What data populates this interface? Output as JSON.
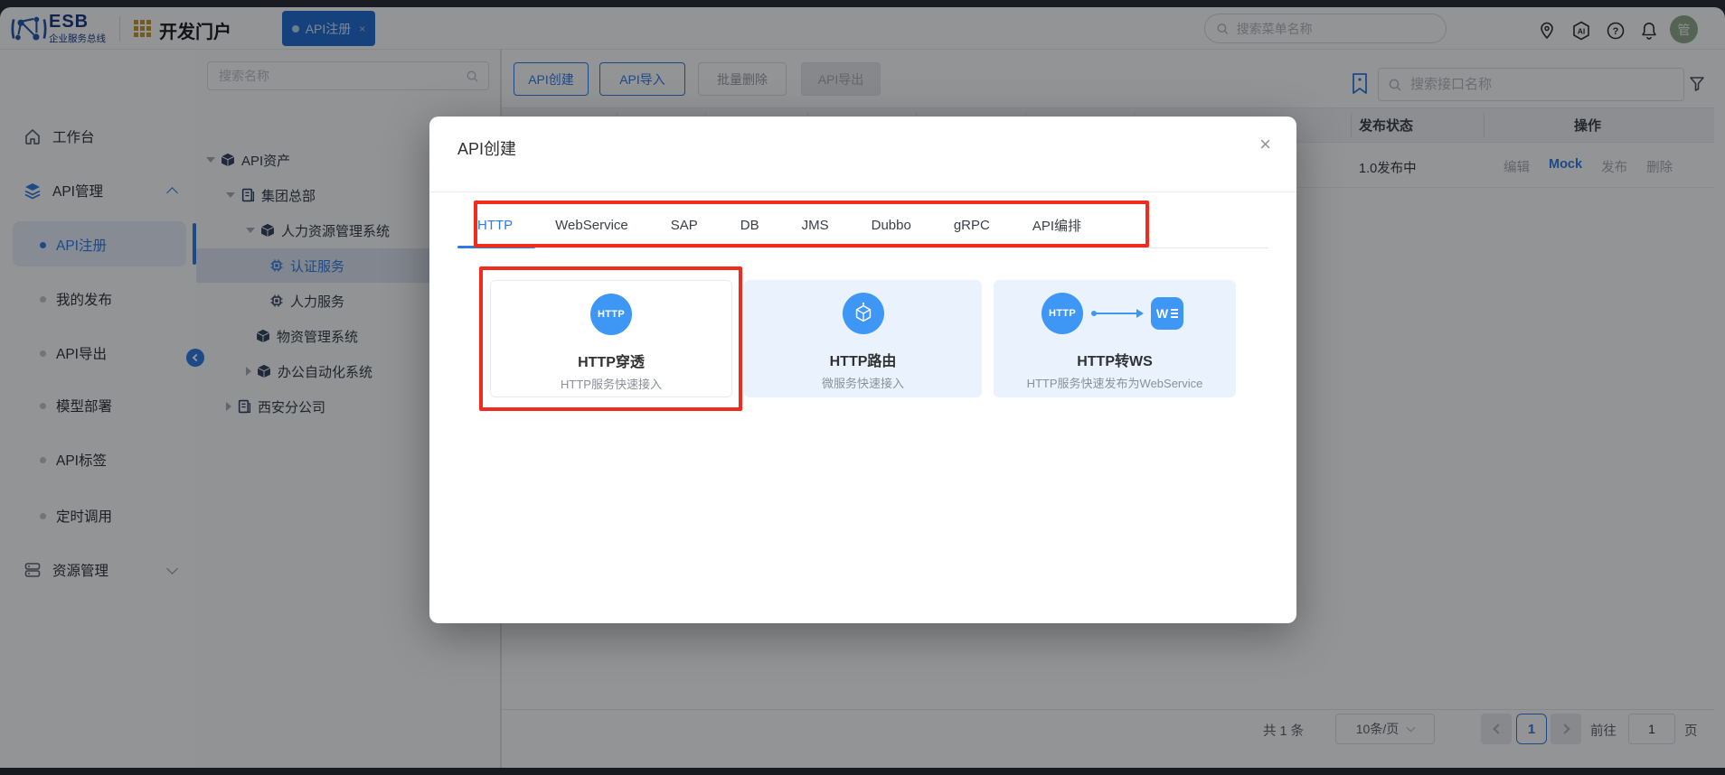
{
  "header": {
    "logo_text": "ESB",
    "logo_subtext": "企业服务总线",
    "portal": "开发门户",
    "active_tab": "API注册",
    "tab_close": "×",
    "menu_search_placeholder": "搜索菜单名称",
    "avatar": "管"
  },
  "sidebar": {
    "workbench": "工作台",
    "api_mgmt": "API管理",
    "api_register": "API注册",
    "my_publish": "我的发布",
    "api_export": "API导出",
    "model_deploy": "模型部署",
    "api_tags": "API标签",
    "timed_call": "定时调用",
    "resource_mgmt": "资源管理"
  },
  "tree": {
    "search_placeholder": "搜索名称",
    "nodes": {
      "api_assets": "API资产",
      "hq": "集团总部",
      "hr_system": "人力资源管理系统",
      "auth_service": "认证服务",
      "hr_service": "人力服务",
      "material_system": "物资管理系统",
      "oa_system": "办公自动化系统",
      "xian_branch": "西安分公司"
    }
  },
  "toolbar": {
    "create": "API创建",
    "import": "API导入",
    "batch_delete": "批量删除",
    "export": "API导出",
    "search_placeholder": "搜索接口名称"
  },
  "table": {
    "col_status": "发布状态",
    "col_actions": "操作",
    "row": {
      "status": "1.0发布中",
      "edit": "编辑",
      "mock": "Mock",
      "publish": "发布",
      "delete": "删除"
    }
  },
  "pagination": {
    "total": "共 1 条",
    "page_size": "10条/页",
    "current": "1",
    "goto_prefix": "前往",
    "goto_value": "1",
    "goto_suffix": "页"
  },
  "modal": {
    "title": "API创建",
    "close": "×",
    "tabs": [
      "HTTP",
      "WebService",
      "SAP",
      "DB",
      "JMS",
      "Dubbo",
      "gRPC",
      "API编排"
    ],
    "cards": [
      {
        "badge": "HTTP",
        "title": "HTTP穿透",
        "desc": "HTTP服务快速接入"
      },
      {
        "title": "HTTP路由",
        "desc": "微服务快速接入"
      },
      {
        "badge": "HTTP",
        "title": "HTTP转WS",
        "desc": "HTTP服务快速发布为WebService"
      }
    ]
  },
  "colors": {
    "primary": "#2d7ce5",
    "card_icon_blue": "#3e97f5",
    "annotation_red": "#f12b1f",
    "active_tab_bg": "#1f6bd0"
  }
}
